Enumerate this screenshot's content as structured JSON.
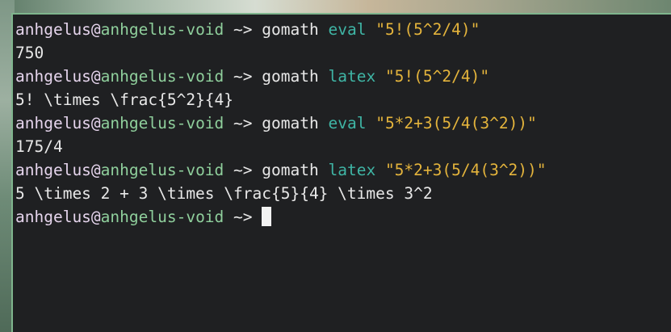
{
  "prompt": {
    "user": "anhgelus",
    "at": "@",
    "host": "anhgelus-void",
    "path": " ~>"
  },
  "entries": [
    {
      "cmd": "gomath",
      "sub": "eval",
      "arg": "\"5!(5^2/4)\"",
      "output": "750"
    },
    {
      "cmd": "gomath",
      "sub": "latex",
      "arg": "\"5!(5^2/4)\"",
      "output": "5! \\times \\frac{5^2}{4}"
    },
    {
      "cmd": "gomath",
      "sub": "eval",
      "arg": "\"5*2+3(5/4(3^2))\"",
      "output": "175/4"
    },
    {
      "cmd": "gomath",
      "sub": "latex",
      "arg": "\"5*2+3(5/4(3^2))\"",
      "output": "5 \\times 2 + 3 \\times \\frac{5}{4} \\times 3^2"
    }
  ],
  "colors": {
    "background": "#1f2022",
    "user": "#e5d4ec",
    "host": "#8fcf9c",
    "subcommand": "#3fb5a5",
    "argument": "#e4b43c",
    "text": "#e8e8e8"
  }
}
